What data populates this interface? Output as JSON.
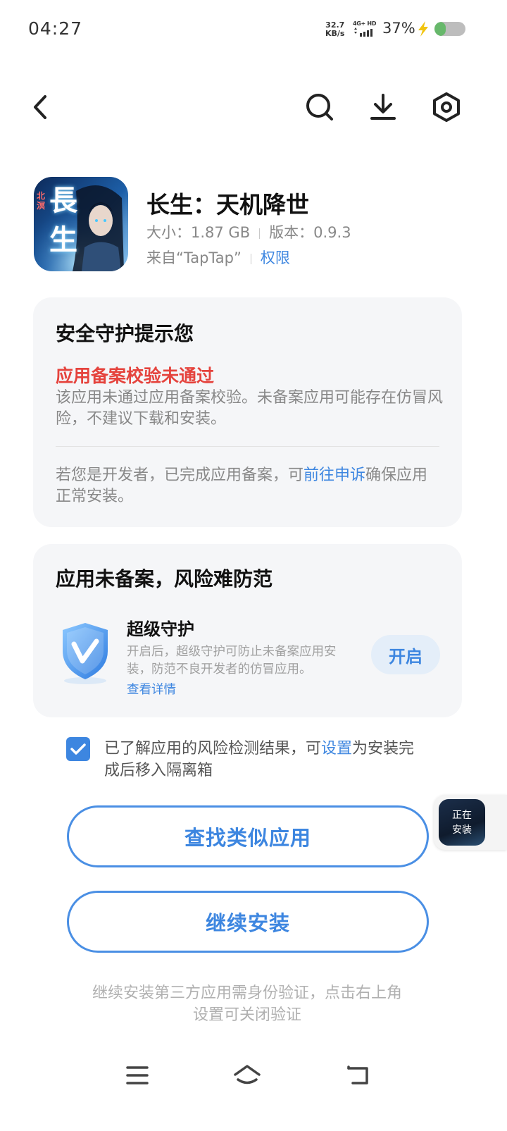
{
  "status_bar": {
    "time": "04:27",
    "speed_value": "32.7",
    "speed_unit": "KB/s",
    "network": "4G+ HD",
    "battery_text": "37%",
    "battery_level": 0.37,
    "battery_color": "#67b86b"
  },
  "nav": {
    "back_icon": "chevron-left-icon",
    "search_icon": "search-icon",
    "download_icon": "download-icon",
    "settings_icon": "hexagon-settings-icon"
  },
  "app": {
    "name": "长生：天机降世",
    "size": "大小：1.87 GB",
    "version": "版本：0.9.3",
    "source": "来自“TapTap”",
    "permissions": "权限",
    "icon_text": "長生",
    "icon_tag": "北溟"
  },
  "warning": {
    "title": "安全守护提示您",
    "headline": "应用备案校验未通过",
    "description": "该应用未通过应用备案校验。未备案应用可能存在仿冒风险，不建议下载和安装。",
    "dev_prefix": "若您是开发者，已完成应用备案，可",
    "dev_link": "前往申诉",
    "dev_suffix": "确保应用正常安装。"
  },
  "protection": {
    "title": "应用未备案，风险难防范",
    "name": "超级守护",
    "description": "开启后，超级守护可防止未备案应用安装，防范不良开发者的仿冒应用。",
    "more_link": "查看详情",
    "enable_label": "开启",
    "icon": "shield-v-icon"
  },
  "acknowledge": {
    "checked": true,
    "prefix": "已了解应用的风险检测结果，可",
    "link": "设置",
    "suffix": "为安装完成后移入隔离箱"
  },
  "buttons": {
    "find_similar": "查找类似应用",
    "continue_install": "继续安装"
  },
  "floating": {
    "label_line1": "正在",
    "label_line2": "安装"
  },
  "footer": {
    "note": "继续安装第三方应用需身份验证，点击右上角设置可关闭验证"
  },
  "system_nav": {
    "menu_icon": "menu-icon",
    "home_icon": "home-icon",
    "back_icon": "back-icon"
  },
  "colors": {
    "accent": "#3d86e0",
    "danger": "#e5433d",
    "card_bg": "#f5f6f8"
  }
}
